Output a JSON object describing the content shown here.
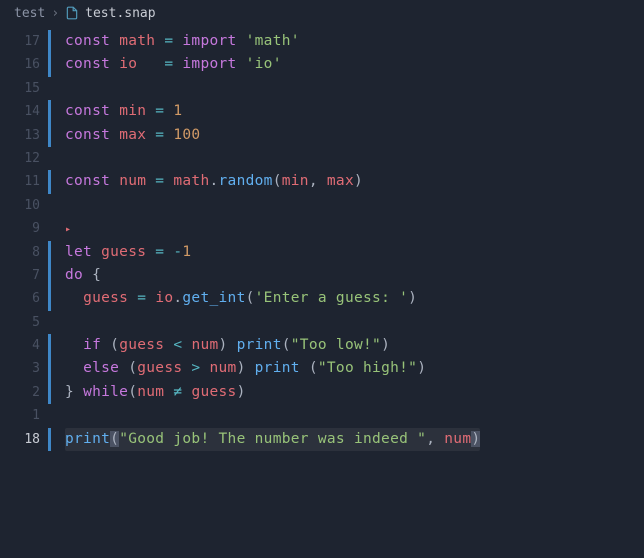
{
  "breadcrumb": {
    "folder": "test",
    "filename": "test.snap"
  },
  "lines": [
    {
      "n": 17,
      "bar": true,
      "tokens": [
        {
          "t": "const ",
          "c": "kw"
        },
        {
          "t": "math",
          "c": "var"
        },
        {
          "t": " = ",
          "c": "op"
        },
        {
          "t": "import ",
          "c": "kw"
        },
        {
          "t": "'math'",
          "c": "str"
        }
      ]
    },
    {
      "n": 16,
      "bar": true,
      "tokens": [
        {
          "t": "const ",
          "c": "kw"
        },
        {
          "t": "io",
          "c": "var"
        },
        {
          "t": "   = ",
          "c": "op"
        },
        {
          "t": "import ",
          "c": "kw"
        },
        {
          "t": "'io'",
          "c": "str"
        }
      ]
    },
    {
      "n": 15,
      "bar": false,
      "tokens": []
    },
    {
      "n": 14,
      "bar": true,
      "tokens": [
        {
          "t": "const ",
          "c": "kw"
        },
        {
          "t": "min",
          "c": "var"
        },
        {
          "t": " = ",
          "c": "op"
        },
        {
          "t": "1",
          "c": "num"
        }
      ]
    },
    {
      "n": 13,
      "bar": true,
      "tokens": [
        {
          "t": "const ",
          "c": "kw"
        },
        {
          "t": "max",
          "c": "var"
        },
        {
          "t": " = ",
          "c": "op"
        },
        {
          "t": "100",
          "c": "num"
        }
      ]
    },
    {
      "n": 12,
      "bar": false,
      "tokens": []
    },
    {
      "n": 11,
      "bar": true,
      "tokens": [
        {
          "t": "const ",
          "c": "kw"
        },
        {
          "t": "num",
          "c": "var"
        },
        {
          "t": " = ",
          "c": "op"
        },
        {
          "t": "math",
          "c": "var"
        },
        {
          "t": ".",
          "c": "punc"
        },
        {
          "t": "random",
          "c": "fn"
        },
        {
          "t": "(",
          "c": "punc"
        },
        {
          "t": "min",
          "c": "var"
        },
        {
          "t": ", ",
          "c": "punc"
        },
        {
          "t": "max",
          "c": "var"
        },
        {
          "t": ")",
          "c": "punc"
        }
      ]
    },
    {
      "n": 10,
      "bar": false,
      "tokens": []
    },
    {
      "n": 9,
      "bar": false,
      "collapse": true,
      "tokens": []
    },
    {
      "n": 8,
      "bar": true,
      "tokens": [
        {
          "t": "let ",
          "c": "kw"
        },
        {
          "t": "guess",
          "c": "var"
        },
        {
          "t": " = ",
          "c": "op"
        },
        {
          "t": "-",
          "c": "op"
        },
        {
          "t": "1",
          "c": "num"
        }
      ]
    },
    {
      "n": 7,
      "bar": true,
      "tokens": [
        {
          "t": "do ",
          "c": "kw"
        },
        {
          "t": "{",
          "c": "punc"
        }
      ]
    },
    {
      "n": 6,
      "bar": true,
      "tokens": [
        {
          "t": "  ",
          "c": "punc"
        },
        {
          "t": "guess",
          "c": "var"
        },
        {
          "t": " = ",
          "c": "op"
        },
        {
          "t": "io",
          "c": "var"
        },
        {
          "t": ".",
          "c": "punc"
        },
        {
          "t": "get_int",
          "c": "fn"
        },
        {
          "t": "(",
          "c": "punc"
        },
        {
          "t": "'Enter a guess: '",
          "c": "str"
        },
        {
          "t": ")",
          "c": "punc"
        }
      ]
    },
    {
      "n": 5,
      "bar": false,
      "tokens": []
    },
    {
      "n": 4,
      "bar": true,
      "tokens": [
        {
          "t": "  ",
          "c": "punc"
        },
        {
          "t": "if ",
          "c": "kw"
        },
        {
          "t": "(",
          "c": "punc"
        },
        {
          "t": "guess",
          "c": "var"
        },
        {
          "t": " < ",
          "c": "op"
        },
        {
          "t": "num",
          "c": "var"
        },
        {
          "t": ") ",
          "c": "punc"
        },
        {
          "t": "print",
          "c": "fn"
        },
        {
          "t": "(",
          "c": "punc"
        },
        {
          "t": "\"Too low!\"",
          "c": "str"
        },
        {
          "t": ")",
          "c": "punc"
        }
      ]
    },
    {
      "n": 3,
      "bar": true,
      "tokens": [
        {
          "t": "  ",
          "c": "punc"
        },
        {
          "t": "else ",
          "c": "kw"
        },
        {
          "t": "(",
          "c": "punc"
        },
        {
          "t": "guess",
          "c": "var"
        },
        {
          "t": " > ",
          "c": "op"
        },
        {
          "t": "num",
          "c": "var"
        },
        {
          "t": ") ",
          "c": "punc"
        },
        {
          "t": "print ",
          "c": "fn"
        },
        {
          "t": "(",
          "c": "punc"
        },
        {
          "t": "\"Too high!\"",
          "c": "str"
        },
        {
          "t": ")",
          "c": "punc"
        }
      ]
    },
    {
      "n": 2,
      "bar": true,
      "tokens": [
        {
          "t": "} ",
          "c": "punc"
        },
        {
          "t": "while",
          "c": "kw"
        },
        {
          "t": "(",
          "c": "punc"
        },
        {
          "t": "num",
          "c": "var"
        },
        {
          "t": " ≠ ",
          "c": "op"
        },
        {
          "t": "guess",
          "c": "var"
        },
        {
          "t": ")",
          "c": "punc"
        }
      ]
    },
    {
      "n": 1,
      "bar": false,
      "tokens": []
    },
    {
      "n": 18,
      "bar": true,
      "current": true,
      "tokens": [
        {
          "t": "print",
          "c": "fn"
        },
        {
          "t": "(",
          "c": "punc",
          "cursor": true
        },
        {
          "t": "\"Good job! The number was indeed \"",
          "c": "str"
        },
        {
          "t": ", ",
          "c": "punc"
        },
        {
          "t": "num",
          "c": "var"
        },
        {
          "t": ")",
          "c": "punc",
          "cursor": true
        }
      ]
    }
  ]
}
